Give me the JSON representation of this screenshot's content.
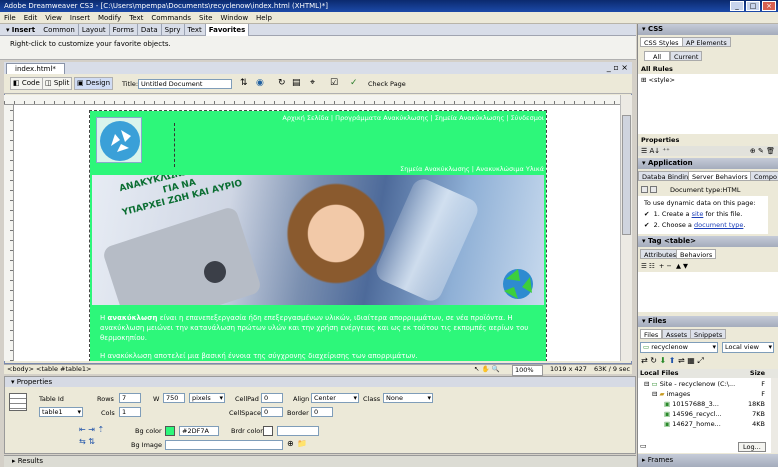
{
  "window": {
    "title": "Adobe Dreamweaver CS3 - [C:\\Users\\mpempa\\Documents\\recyclenow\\index.html (XHTML)*]"
  },
  "menu": [
    "File",
    "Edit",
    "View",
    "Insert",
    "Modify",
    "Text",
    "Commands",
    "Site",
    "Window",
    "Help"
  ],
  "insert_bar": {
    "label": "Insert",
    "tabs": [
      "Common",
      "Layout",
      "Forms",
      "Data",
      "Spry",
      "Text",
      "Favorites"
    ],
    "selected": "Favorites",
    "hint": "Right-click to customize your favorite objects."
  },
  "doc": {
    "tab": "index.html*",
    "view_buttons": [
      "Code",
      "Split",
      "Design"
    ],
    "title_label": "Title:",
    "title_value": "Untitled Document",
    "check_page": "Check Page"
  },
  "page": {
    "bg_color": "#2DF7A",
    "nav_top": "Αρχική Σελίδα | Προγράμματα Ανακύκλωσης | Σημεία Ανακύκλωσης | Σύνδεσμοι",
    "nav_sub": "Σημεία Ανακύκλωσης | Ανακυκλώσιμα Υλικά",
    "banner_line1": "ΑΝΑΚΥΚΛΩΝΩ ΣΗΜΕΡΑ",
    "banner_line2": "ΓΙΑ ΝΑ",
    "banner_line3": "ΥΠΑΡΧΕΙ ΖΩΗ ΚΑΙ ΑΥΡΙΟ",
    "para1_bold": "ανακύκλωση",
    "para1_prefix": "Η ",
    "para1_rest": " είναι η επανεπεξεργασία ήδη επεξεργασμένων υλικών, ιδιαίτερα απορριμμάτων, σε νέα προϊόντα. Η ανακύκλωση μειώνει την κατανάλωση πρώτων υλών και την χρήση ενέργειας και ως εκ τούτου τις εκπομπές αερίων του θερμοκηπίου.",
    "para2": "Η ανακύκλωση αποτελεί μια βασική έννοια της σύγχρονης διαχείρισης των απορριμάτων."
  },
  "status": {
    "tags": "<body> <table #table1>",
    "zoom": "100%",
    "size": "1019 x 427",
    "weight": "63K / 9 sec"
  },
  "properties": {
    "header": "Properties",
    "table_id_label": "Table Id",
    "table_id": "table1",
    "rows_label": "Rows",
    "rows": "7",
    "cols_label": "Cols",
    "cols": "1",
    "w_label": "W",
    "w": "750",
    "w_unit": "pixels",
    "cellpad_label": "CellPad",
    "cellpad": "0",
    "cellspace_label": "CellSpace",
    "cellspace": "0",
    "align_label": "Align",
    "align": "Center",
    "border_label": "Border",
    "border": "0",
    "class_label": "Class",
    "class": "None",
    "bgcolor_label": "Bg color",
    "bgcolor": "#2DF7A",
    "brdr_label": "Brdr color",
    "bgimage_label": "Bg Image"
  },
  "results_label": "Results",
  "panels": {
    "css_header": "CSS",
    "css_tabs": [
      "CSS Styles",
      "AP Elements"
    ],
    "css_subtabs": [
      "All",
      "Current"
    ],
    "all_rules": "All Rules",
    "style_rule": "<style>",
    "properties_label": "Properties",
    "application_header": "Application",
    "app_tabs": [
      "Databa Bindings",
      "Server Behaviors",
      "Compo"
    ],
    "doc_type": "Document type:HTML",
    "dyn_hint": "To use dynamic data on this page:",
    "step1_pre": "1. Create a ",
    "step1_link": "site",
    "step1_post": " for this file.",
    "step2_pre": "2. Choose a ",
    "step2_link": "document type",
    "step2_post": ".",
    "tag_header": "Tag <table>",
    "tag_tabs": [
      "Attributes",
      "Behaviors"
    ],
    "files_header": "Files",
    "files_tabs": [
      "Files",
      "Assets",
      "Snippets"
    ],
    "site_select": "recyclenow",
    "view_select": "Local view",
    "local_files_label": "Local Files",
    "size_label": "Size",
    "tree": [
      {
        "name": "Site - recyclenow (C:\\...",
        "size": "F"
      },
      {
        "name": "images",
        "size": "F"
      },
      {
        "name": "10157688_3...",
        "size": "18KB"
      },
      {
        "name": "14596_recycl...",
        "size": "7KB"
      },
      {
        "name": "14627_home...",
        "size": "4KB"
      }
    ],
    "log_button": "Log...",
    "frames_label": "Frames"
  },
  "colors": {
    "page_green": "#2DF77A",
    "accent": "#0b2a6e"
  }
}
